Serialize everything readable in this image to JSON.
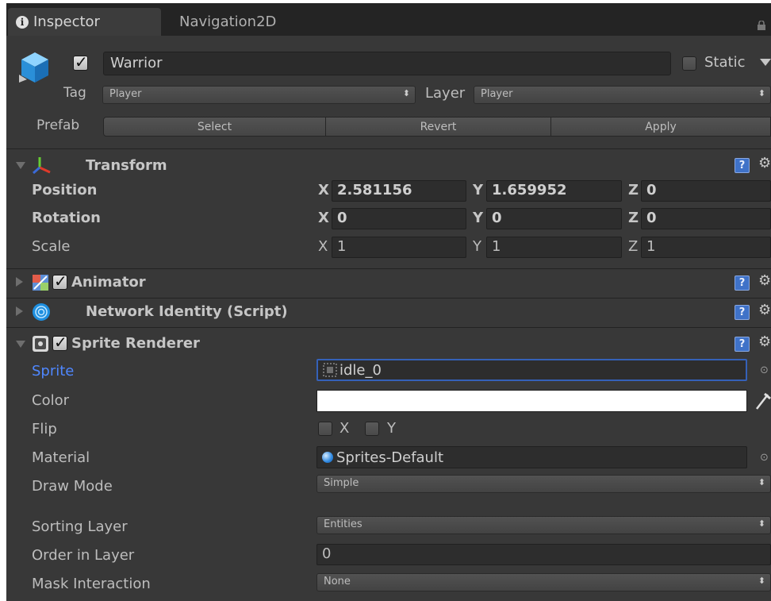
{
  "tabs": [
    "Inspector",
    "Navigation2D"
  ],
  "object": {
    "name": "Warrior",
    "static_label": "Static",
    "active": true,
    "static": false
  },
  "tag": {
    "label": "Tag",
    "value": "Player"
  },
  "layer": {
    "label": "Layer",
    "value": "Player"
  },
  "prefab": {
    "label": "Prefab",
    "buttons": [
      "Select",
      "Revert",
      "Apply"
    ]
  },
  "transform": {
    "title": "Transform",
    "rows": [
      {
        "label": "Position",
        "x": "2.581156",
        "y": "1.659952",
        "z": "0"
      },
      {
        "label": "Rotation",
        "x": "0",
        "y": "0",
        "z": "0"
      },
      {
        "label": "Scale",
        "x": "1",
        "y": "1",
        "z": "1"
      }
    ],
    "axes": [
      "X",
      "Y",
      "Z"
    ]
  },
  "components": {
    "animator": "Animator",
    "network_identity": "Network Identity (Script)",
    "sprite_renderer": "Sprite Renderer"
  },
  "sprite_renderer": {
    "sprite_label": "Sprite",
    "sprite_value": "idle_0",
    "color_label": "Color",
    "color_value": "#ffffff",
    "flip_label": "Flip",
    "flip_x": "X",
    "flip_y": "Y",
    "material_label": "Material",
    "material_value": "Sprites-Default",
    "draw_mode_label": "Draw Mode",
    "draw_mode_value": "Simple",
    "sorting_layer_label": "Sorting Layer",
    "sorting_layer_value": "Entities",
    "order_label": "Order in Layer",
    "order_value": "0",
    "mask_label": "Mask Interaction",
    "mask_value": "None"
  },
  "icons": {
    "help": "?",
    "gear": "⚙",
    "dropdown_arrow": "⬍"
  },
  "colors": {
    "panel": "#383838",
    "accent_blue": "#4f87ff",
    "help_blue": "#3f72c8"
  }
}
